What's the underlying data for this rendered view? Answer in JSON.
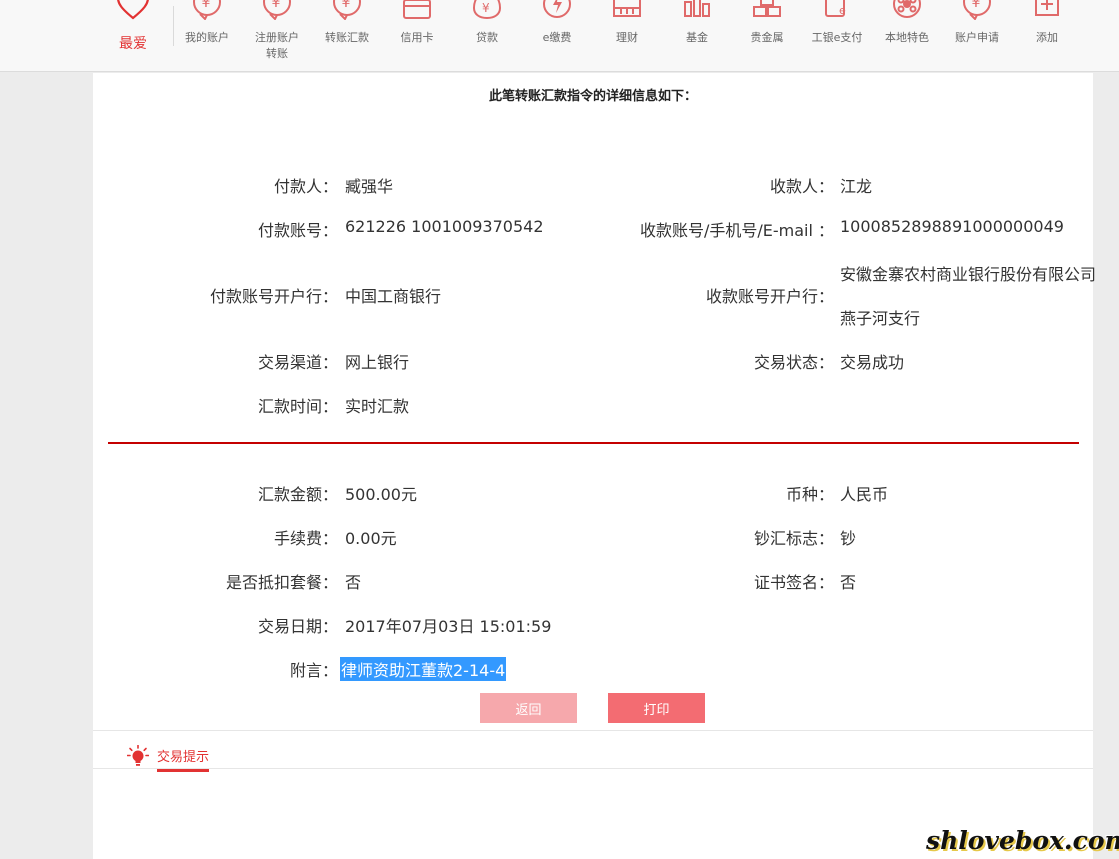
{
  "nav": {
    "favorite_label": "最爱",
    "items": [
      {
        "label": "我的账户",
        "icon": "account-icon"
      },
      {
        "label": "注册账户\n转账",
        "icon": "registered-transfer-icon"
      },
      {
        "label": "转账汇款",
        "icon": "transfer-icon"
      },
      {
        "label": "信用卡",
        "icon": "credit-card-icon"
      },
      {
        "label": "贷款",
        "icon": "loan-icon"
      },
      {
        "label": "e缴费",
        "icon": "e-payment-icon"
      },
      {
        "label": "理财",
        "icon": "wealth-icon"
      },
      {
        "label": "基金",
        "icon": "fund-icon"
      },
      {
        "label": "贵金属",
        "icon": "precious-metal-icon"
      },
      {
        "label": "工银e支付",
        "icon": "icbc-epay-icon"
      },
      {
        "label": "本地特色",
        "icon": "local-feature-icon"
      },
      {
        "label": "账户申请",
        "icon": "account-apply-icon"
      },
      {
        "label": "添加",
        "icon": "add-icon"
      }
    ],
    "accent_color": "#e23232"
  },
  "detail": {
    "title": "此笔转账汇款指令的详细信息如下：",
    "payer_label": "付款人：",
    "payer": "臧强华",
    "payee_label": "收款人：",
    "payee": "江龙",
    "payer_account_label": "付款账号：",
    "payer_account": "621226 1001009370542",
    "payee_account_label": "收款账号/手机号/E-mail ：",
    "payee_account": "1000852898891000000049",
    "payer_bank_label": "付款账号开户行：",
    "payer_bank": "中国工商银行",
    "payee_bank_label": "收款账号开户行：",
    "payee_bank_line1": "安徽金寨农村商业银行股份有限公司",
    "payee_bank_line2": "燕子河支行",
    "channel_label": "交易渠道：",
    "channel": "网上银行",
    "status_label": "交易状态：",
    "status": "交易成功",
    "remit_time_label": "汇款时间：",
    "remit_time": "实时汇款",
    "amount_label": "汇款金额：",
    "amount": "500.00元",
    "currency_label": "币种：",
    "currency": "人民币",
    "fee_label": "手续费：",
    "fee": "0.00元",
    "cash_flag_label": "钞汇标志：",
    "cash_flag": "钞",
    "package_deduct_label": "是否抵扣套餐：",
    "package_deduct": "否",
    "cert_sign_label": "证书签名：",
    "cert_sign": "否",
    "trade_date_label": "交易日期：",
    "trade_date": "2017年07月03日 15:01:59",
    "note_label": "附言：",
    "note": "律师资助江董款2-14-4"
  },
  "buttons": {
    "back": "返回",
    "print": "打印"
  },
  "tips": {
    "title": "交易提示"
  },
  "watermark": "shlovebox.com"
}
